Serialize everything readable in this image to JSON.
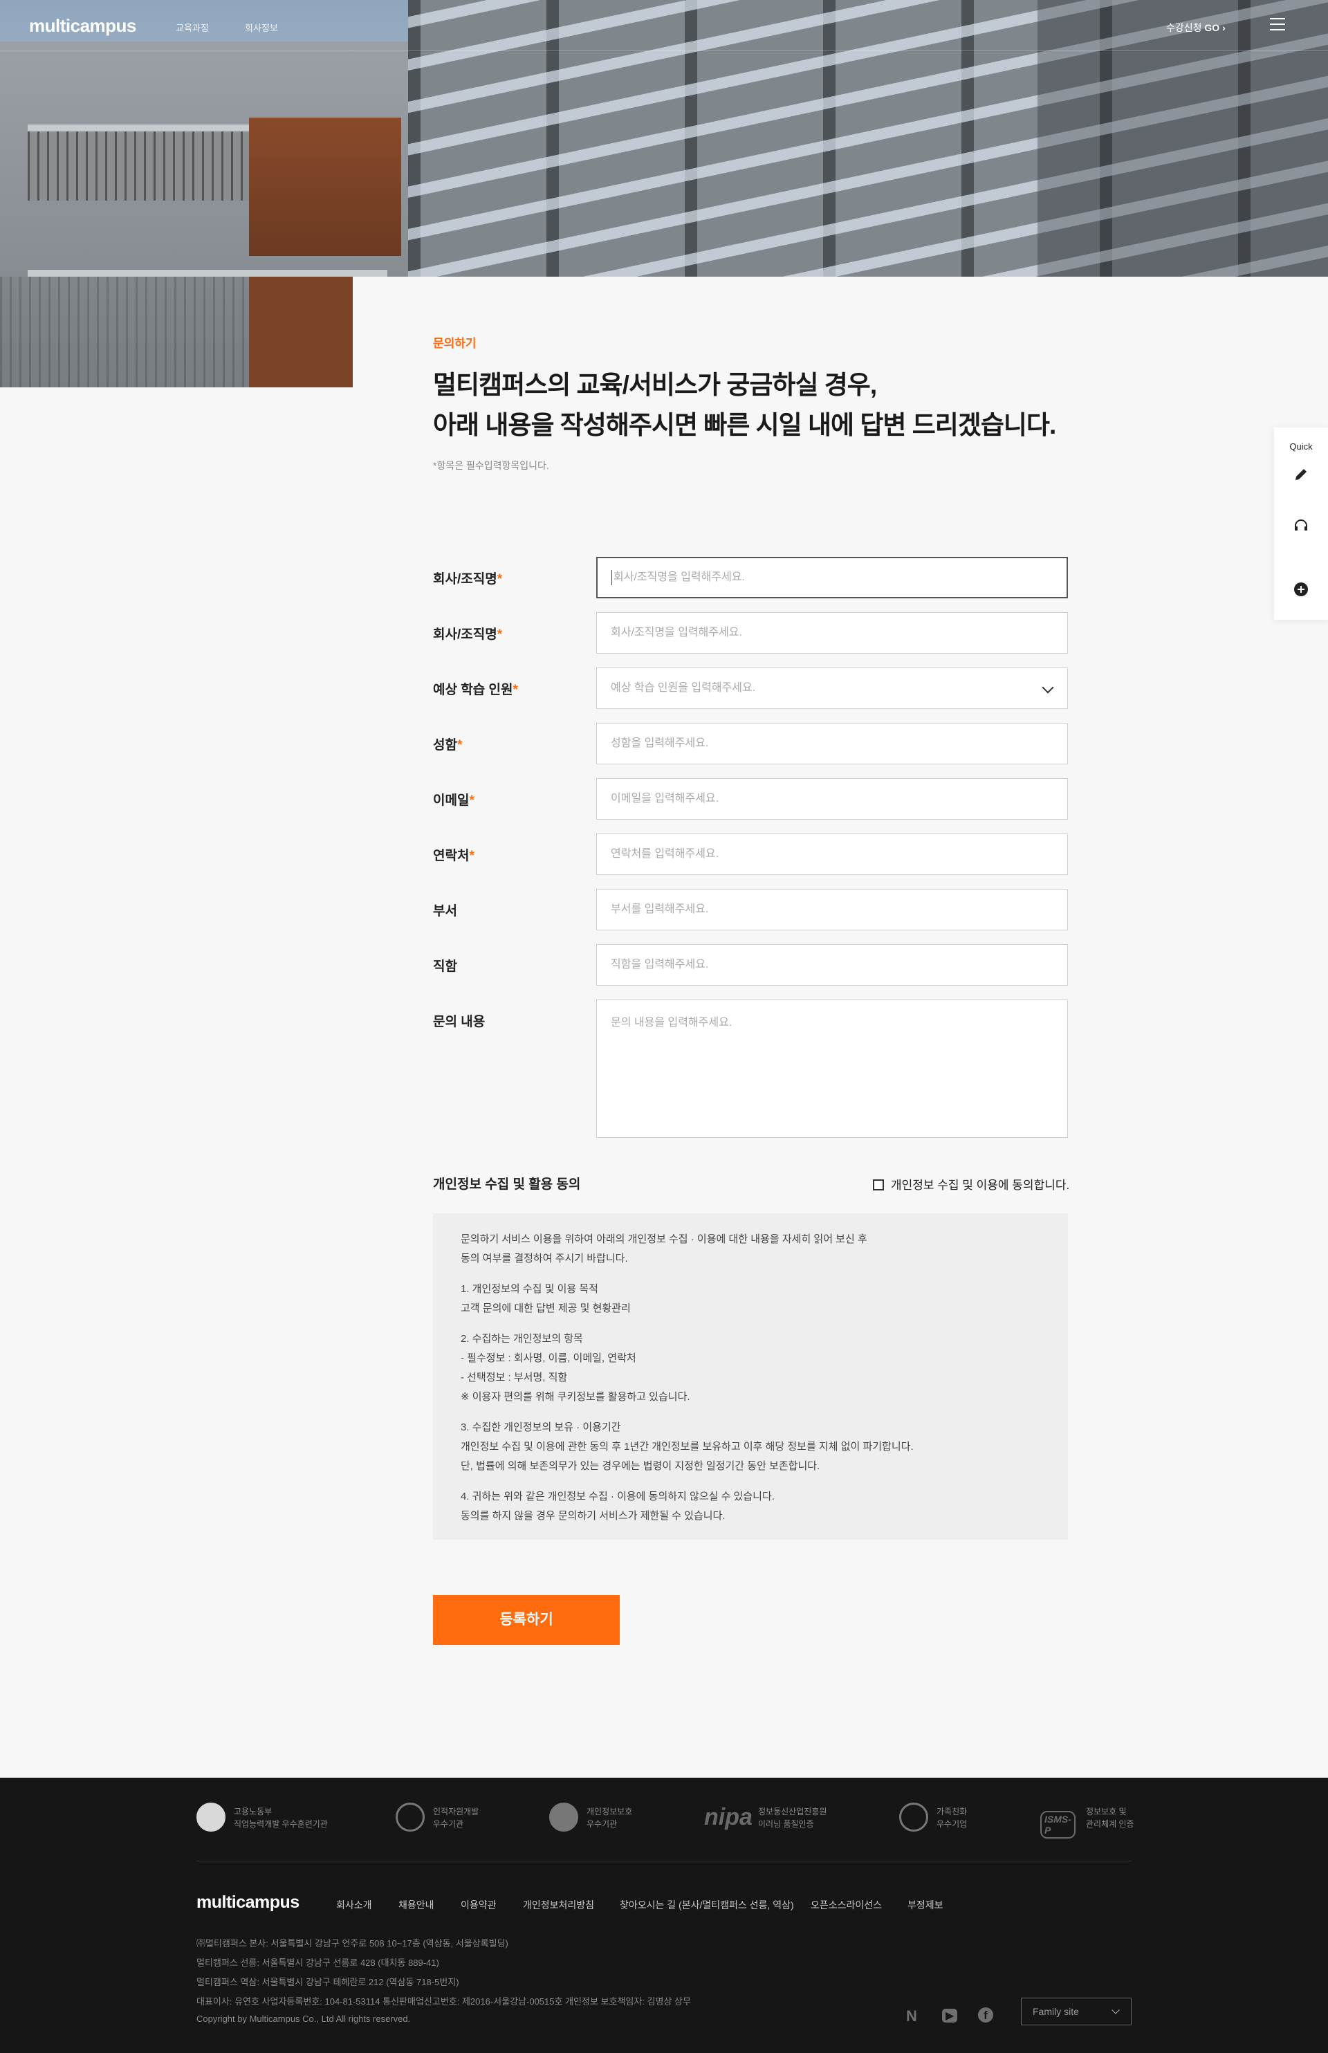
{
  "header": {
    "logo": "multicampus",
    "nav": [
      "교육과정",
      "회사정보"
    ],
    "apply_label": "수강신청",
    "apply_go": "GO",
    "apply_arrow": "›"
  },
  "intro": {
    "eyebrow": "문의하기",
    "headline_line1": "멀티캠퍼스의 교육/서비스가 궁금하실 경우,",
    "headline_line2": "아래 내용을 작성해주시면 빠른 시일 내에 답변 드리겠습니다.",
    "required_note": "*항목은 필수입력항목입니다."
  },
  "form": {
    "rows": [
      {
        "label": "회사/조직명",
        "required": true,
        "placeholder": "회사/조직명을 입력해주세요."
      },
      {
        "label": "회사/조직명",
        "required": true,
        "placeholder": "회사/조직명을 입력해주세요."
      },
      {
        "label": "예상 학습 인원",
        "required": true,
        "placeholder": "예상 학습 인원을 입력해주세요."
      },
      {
        "label": "성함",
        "required": true,
        "placeholder": "성함을 입력해주세요."
      },
      {
        "label": "이메일",
        "required": true,
        "placeholder": "이메일을 입력해주세요."
      },
      {
        "label": "연락처",
        "required": true,
        "placeholder": "연락처를 입력해주세요."
      },
      {
        "label": "부서",
        "required": false,
        "placeholder": "부서를 입력해주세요."
      },
      {
        "label": "직함",
        "required": false,
        "placeholder": "직함을 입력해주세요."
      },
      {
        "label": "문의 내용",
        "required": false,
        "placeholder": "문의 내용을 입력해주세요."
      }
    ],
    "required_mark": "*"
  },
  "consent": {
    "title": "개인정보 수집 및 활용 동의",
    "checkbox_label": "개인정보 수집 및 이용에 동의합니다.",
    "paragraphs": [
      [
        "문의하기 서비스 이용을 위하여 아래의 개인정보 수집 · 이용에 대한 내용을 자세히 읽어 보신 후",
        "동의 여부를 결정하여 주시기 바랍니다."
      ],
      [
        "1. 개인정보의 수집 및 이용 목적",
        "고객 문의에 대한 답변 제공 및 현황관리"
      ],
      [
        "2. 수집하는 개인정보의 항목",
        "- 필수정보 : 회사명, 이름, 이메일, 연락처",
        "- 선택정보 : 부서명, 직함",
        "※ 이용자 편의를 위해 쿠키정보를 활용하고 있습니다."
      ],
      [
        "3. 수집한 개인정보의 보유 · 이용기간",
        "개인정보 수집 및 이용에 관한 동의 후 1년간 개인정보를 보유하고 이후 해당 정보를 지체 없이 파기합니다.",
        "단, 법률에 의해 보존의무가 있는 경우에는 법령이 지정한 일정기간 동안 보존합니다."
      ],
      [
        "4. 귀하는 위와 같은 개인정보 수집 · 이용에 동의하지 않으실 수 있습니다.",
        "동의를 하지 않을 경우 문의하기 서비스가 제한될 수 있습니다."
      ]
    ]
  },
  "submit_label": "등록하기",
  "quick": {
    "title": "Quick"
  },
  "footer": {
    "certs": [
      {
        "line1": "고용노동부",
        "line2": "직업능력개발 우수훈련기관"
      },
      {
        "line1": "인적자원개발",
        "line2": "우수기관"
      },
      {
        "line1": "개인정보보호",
        "line2": "우수기관"
      },
      {
        "logo": "nipa",
        "line1": "정보통신산업진흥원",
        "line2": "이러닝 품질인증"
      },
      {
        "line1": "가족친화",
        "line2": "우수기업"
      },
      {
        "logo": "ISMS-P",
        "line1": "정보보호 및",
        "line2": "관리체계 인증"
      }
    ],
    "logo": "multicampus",
    "links": [
      "회사소개",
      "채용안내",
      "이용약관",
      "개인정보처리방침",
      "찾아오시는 길 (본사/멀티캠퍼스 선릉, 역삼)",
      "오픈소스라이선스",
      "부정제보"
    ],
    "address": [
      "㈜멀티캠퍼스 본사: 서울특별시 강남구 언주로 508 10~17층 (역삼동, 서울상록빌딩)",
      "멀티캠퍼스 선릉: 서울특별시 강남구 선릉로 428 (대치동 889-41)",
      "멀티캠퍼스 역삼: 서울특별시 강남구 테헤란로 212 (역삼동 718-5번지)",
      "대표이사: 유연호    사업자등록번호: 104-81-53114    통신판매업신고번호: 제2016-서울강남-00515호    개인정보 보호책임자: 김명상 상무",
      "Copyright by Multicampus Co., Ltd All rights reserved."
    ],
    "social": [
      "N",
      "▶",
      "f"
    ],
    "family_site": "Family site"
  },
  "colors": {
    "accent": "#ff6c0f",
    "footer_bg": "#161616",
    "page_bg": "#f7f7f7"
  }
}
